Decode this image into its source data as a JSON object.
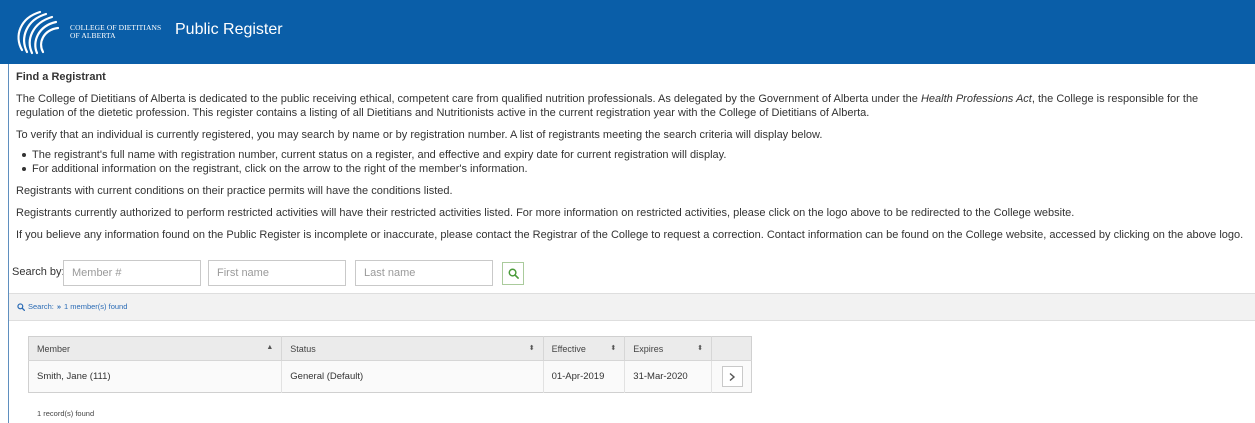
{
  "header": {
    "org_line1": "COLLEGE OF DIETITIANS",
    "org_line2": "OF ALBERTA",
    "title": "Public Register",
    "bg_color": "#0a5ea8"
  },
  "intro": {
    "heading": "Find a Registrant",
    "p1_before": "The College of Dietitians of Alberta is dedicated to the public receiving ethical, competent care from qualified nutrition professionals. As delegated by the Government of Alberta under the ",
    "p1_act": "Health Professions Act",
    "p1_after": ", the College is responsible for the regulation of the dietetic profession. This register contains a listing of all Dietitians and Nutritionists active in the current registration year with the College of Dietitians of Alberta.",
    "p2": "To verify that an individual is currently registered, you may search by name or by registration number. A list of registrants meeting the search criteria will display below.",
    "bullets": [
      "The registrant's full name with registration number, current status on a register, and effective and expiry date for current registration will display.",
      "For additional information on the registrant, click on the arrow to the right of the member's information."
    ],
    "p3": "Registrants with current conditions on their practice permits will have the conditions listed.",
    "p4": "Registrants currently authorized to perform restricted activities will have their restricted activities listed. For more information on restricted activities, please click on the logo above to be redirected to the College website.",
    "p5": "If you believe any information found on the Public Register is incomplete or inaccurate, please contact the Registrar of the College to request a correction. Contact information can be found on the College website, accessed by clicking on the above logo."
  },
  "search": {
    "label": "Search by:",
    "member_placeholder": "Member #",
    "first_placeholder": "First name",
    "last_placeholder": "Last name",
    "member_value": "",
    "first_value": "",
    "last_value": "",
    "button_icon": "search-icon"
  },
  "result_bar": {
    "prefix": "Search:",
    "separator": "»",
    "summary": "1 member(s) found"
  },
  "grid": {
    "columns": [
      "Member",
      "Status",
      "Effective",
      "Expires"
    ],
    "sort_icons": [
      "▲",
      "⬍",
      "⬍",
      "⬍"
    ],
    "rows": [
      {
        "member": "Smith, Jane (111)",
        "status": "General (Default)",
        "effective": "01-Apr-2019",
        "expires": "31-Mar-2020"
      }
    ],
    "row_button_icon": "chevron-right-icon"
  },
  "footer": {
    "count": "1 record(s) found"
  }
}
